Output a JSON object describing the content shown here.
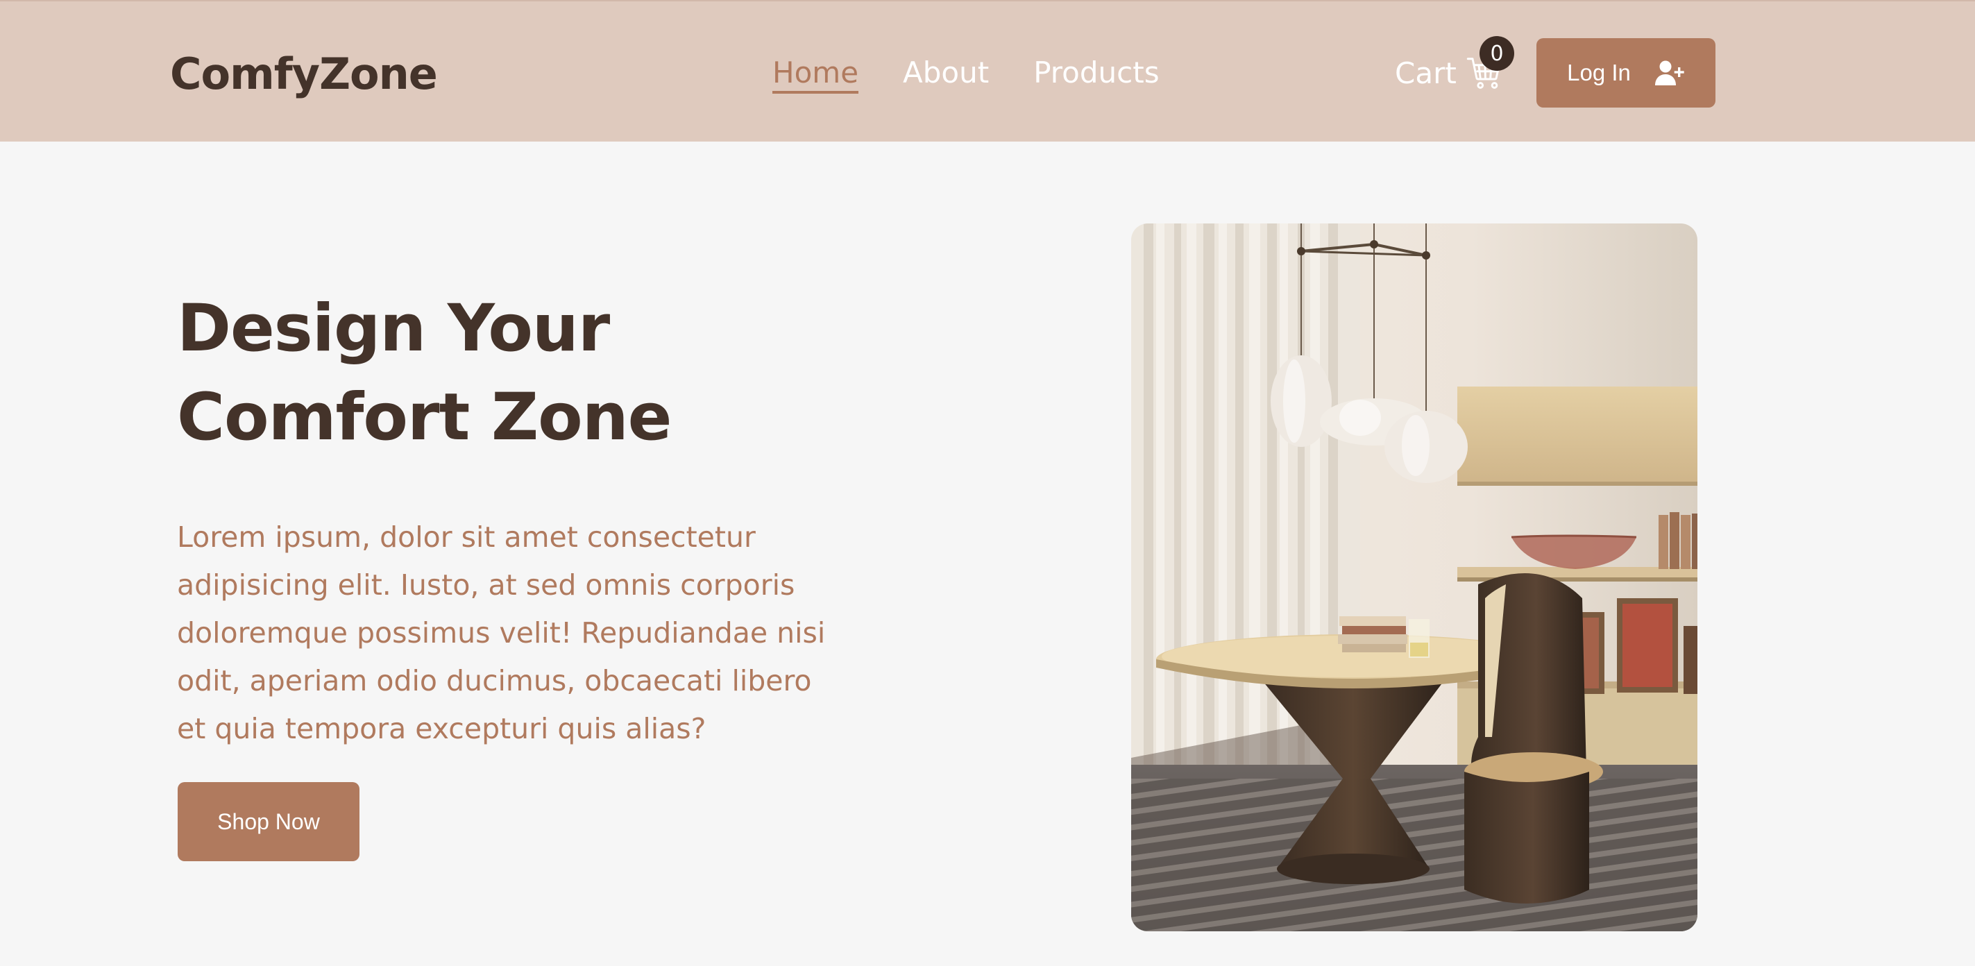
{
  "navbar": {
    "logo": "ComfyZone",
    "links": [
      {
        "label": "Home",
        "active": true
      },
      {
        "label": "About",
        "active": false
      },
      {
        "label": "Products",
        "active": false
      }
    ],
    "cart_label": "Cart",
    "cart_count": "0",
    "login_label": "Log In"
  },
  "hero": {
    "title_line1": "Design Your",
    "title_line2": "Comfort Zone",
    "text": "Lorem ipsum, dolor sit amet consectetur adipisicing elit. Iusto, at sed omnis corporis doloremque possimus velit! Repudiandae nisi odit, aperiam odio ducimus, obcaecati libero et quia tempora excepturi quis alias?",
    "button_label": "Shop Now"
  },
  "icons": {
    "cart": "shopping-cart-icon",
    "login": "user-plus-icon"
  },
  "colors": {
    "navbar_bg": "#dfcabe",
    "brand_dark": "#44332a",
    "accent": "#b07a5e",
    "page_bg": "#f6f6f6"
  }
}
